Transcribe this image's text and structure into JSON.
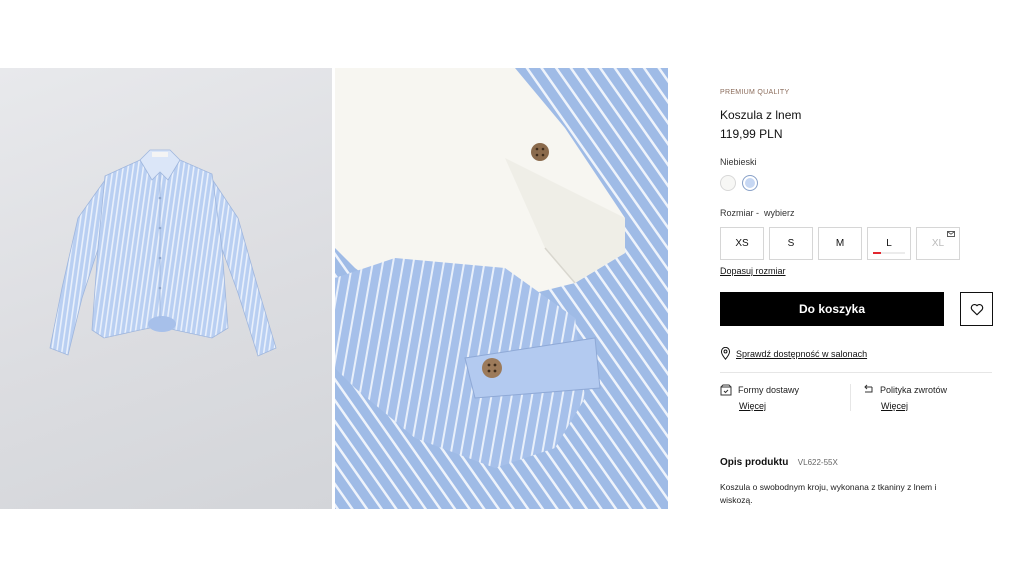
{
  "product": {
    "eyebrow": "PREMIUM QUALITY",
    "title": "Koszula z lnem",
    "price": "119,99 PLN",
    "color_name": "Niebieski",
    "swatches": [
      {
        "name": "white",
        "color": "#f7f7f5"
      },
      {
        "name": "blue",
        "color": "#c6d7f3",
        "selected": true
      }
    ],
    "size_prefix": "Rozmiar -",
    "size_choose": "wybierz",
    "sizes": [
      {
        "label": "XS",
        "available": true
      },
      {
        "label": "S",
        "available": true
      },
      {
        "label": "M",
        "available": true
      },
      {
        "label": "L",
        "available": true,
        "low_stock_fraction": 0.25
      },
      {
        "label": "XL",
        "available": false,
        "notify": true
      }
    ],
    "fit_link": "Dopasuj rozmiar",
    "cart_button": "Do koszyka",
    "stores_link": "Sprawdź dostępność w salonach",
    "delivery": {
      "label": "Formy dostawy",
      "more": "Więcej"
    },
    "returns": {
      "label": "Polityka zwrotów",
      "more": "Więcej"
    },
    "description": {
      "heading": "Opis produktu",
      "code": "VL622-55X",
      "text": "Koszula o swobodnym kroju, wykonana z tkaniny z lnem i wiskozą."
    }
  },
  "colors": {
    "accent_eyebrow": "#8a6b5a",
    "cart_bg": "#000000",
    "low_stock": "#e2272f",
    "shirt_blue": "#b7cdf0"
  },
  "icons": {
    "wishlist": "heart-icon",
    "stores": "location-pin-icon",
    "delivery": "box-icon",
    "returns": "return-arrow-icon",
    "notify": "envelope-icon"
  }
}
